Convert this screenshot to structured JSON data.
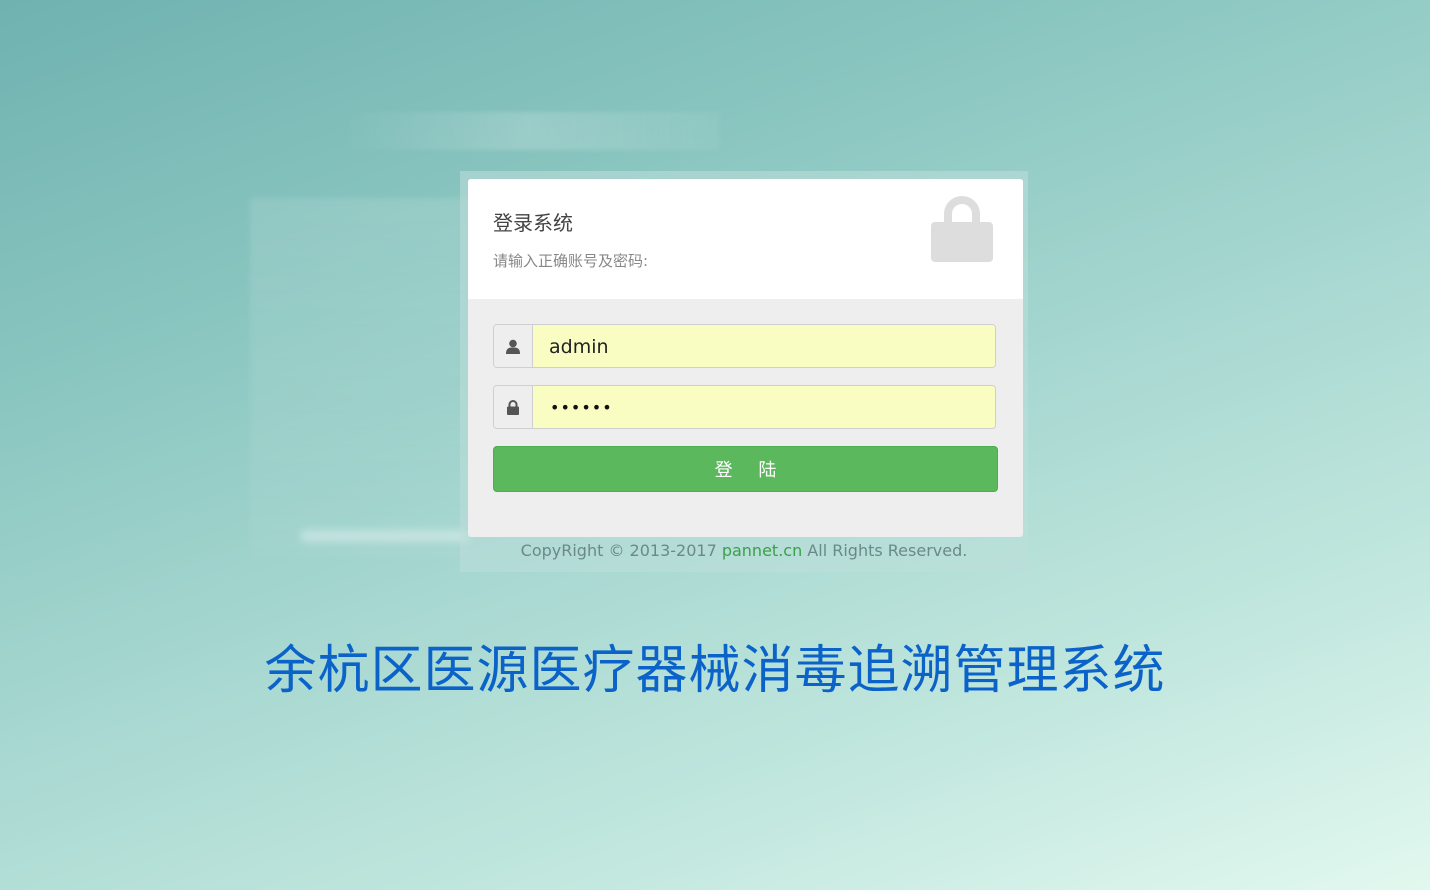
{
  "login_card": {
    "title": "登录系统",
    "subtitle": "请输入正确账号及密码:",
    "lock_icon": "lock-icon"
  },
  "username": {
    "icon": "user-icon",
    "value": "admin"
  },
  "password": {
    "icon": "lock-icon",
    "masked_value": "••••••"
  },
  "login_button": {
    "label": "登 陆"
  },
  "footer": {
    "prefix": "CopyRight © 2013-2017 ",
    "brand": "pannet.cn",
    "suffix": " All Rights Reserved."
  },
  "system_title": "余杭区医源医疗器械消毒追溯管理系统",
  "colors": {
    "button_green": "#5cb85c",
    "input_autofill": "#f9fdc2",
    "title_blue": "#0b63c9",
    "brand_green": "#3aa04a"
  }
}
